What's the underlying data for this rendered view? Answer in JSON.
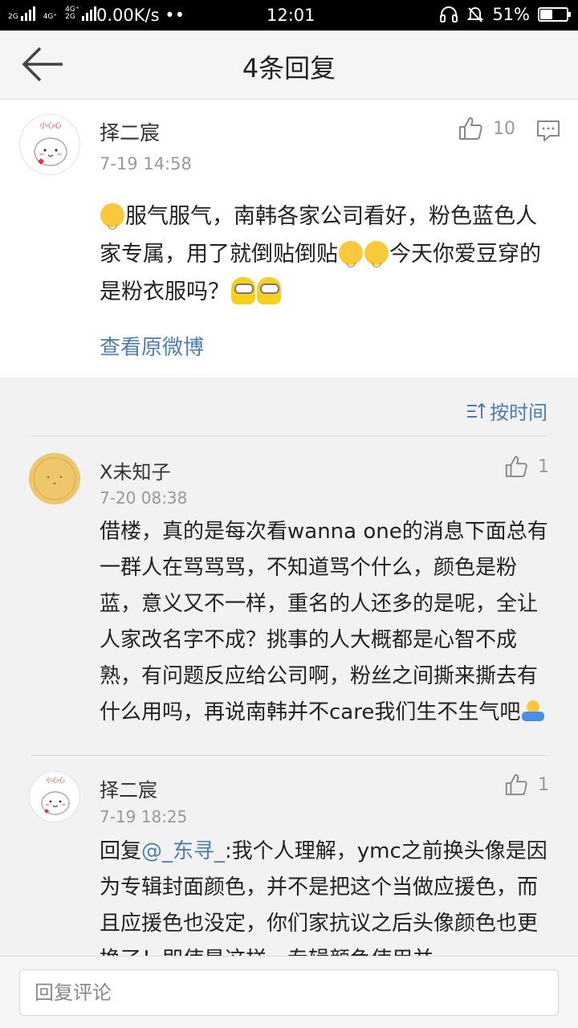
{
  "status_bar": {
    "sim1": "2G",
    "sim1_b": "4G⁺",
    "sim2": "4G⁺",
    "sim2_b": "2G",
    "net_speed": "0.00K/s",
    "dots": "•",
    "time": "12:01",
    "battery": "51%",
    "battery_level": 0.51
  },
  "header": {
    "title": "4条回复"
  },
  "main_comment": {
    "user": "择二宸",
    "time": "7-19 14:58",
    "likes": "10",
    "text_1": "服气服气，南韩各家公司看好，粉色蓝色人家专属，用了就倒贴倒贴",
    "text_2": "今天你爱豆穿的是粉衣服吗？",
    "view_original": "查看原微博",
    "avatar_text": "小心心"
  },
  "sort": {
    "label": "按时间"
  },
  "replies": [
    {
      "user": "X未知子",
      "time": "7-20 08:38",
      "likes": "1",
      "text": "借楼，真的是每次看wanna one的消息下面总有一群人在骂骂骂，不知道骂个什么，颜色是粉蓝，意义又不一样，重名的人还多的是呢，全让人家改名字不成？挑事的人大概都是心智不成熟，有问题反应给公司啊，粉丝之间撕来撕去有什么用吗，再说南韩并不care我们生不生气吧"
    },
    {
      "user": "择二宸",
      "time": "7-19 18:25",
      "likes": "1",
      "reply_prefix": "回复",
      "mention": "@_东寻_",
      "text": ":我个人理解，ymc之前换头像是因为专辑封面颜色，并不是把这个当做应援色，而且应援色也没定，你们家抗议之后头像颜色也更换了！即使是这样，专辑颜色使用并",
      "avatar_text": "小心心"
    }
  ],
  "input": {
    "placeholder": "回复评论"
  },
  "colors": {
    "link": "#4f7db2",
    "background": "#f2f2f2"
  }
}
